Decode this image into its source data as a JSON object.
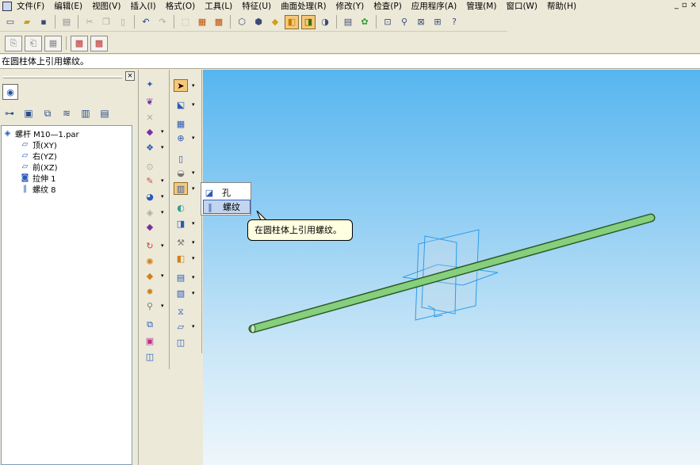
{
  "menu": {
    "items": [
      "文件(F)",
      "编辑(E)",
      "视图(V)",
      "插入(I)",
      "格式(O)",
      "工具(L)",
      "特征(U)",
      "曲面处理(R)",
      "修改(Y)",
      "检查(P)",
      "应用程序(A)",
      "管理(M)",
      "窗口(W)",
      "帮助(H)"
    ],
    "window_controls": [
      "_",
      "▫",
      "×"
    ]
  },
  "status_bar": {
    "text": "在圆柱体上引用螺纹。"
  },
  "tree": {
    "root": "螺杆 M10—1.par",
    "items": [
      "顶(XY)",
      "右(YZ)",
      "前(XZ)",
      "拉伸 1",
      "螺纹 8"
    ]
  },
  "flyout": {
    "items": [
      "孔",
      "螺纹"
    ],
    "selected": 1
  },
  "tooltip": {
    "text": "在圆柱体上引用螺纹。"
  },
  "colors": {
    "rod": "#86cf7c",
    "ref_plane": "#2d9de8",
    "highlight": "#f7c87a"
  }
}
